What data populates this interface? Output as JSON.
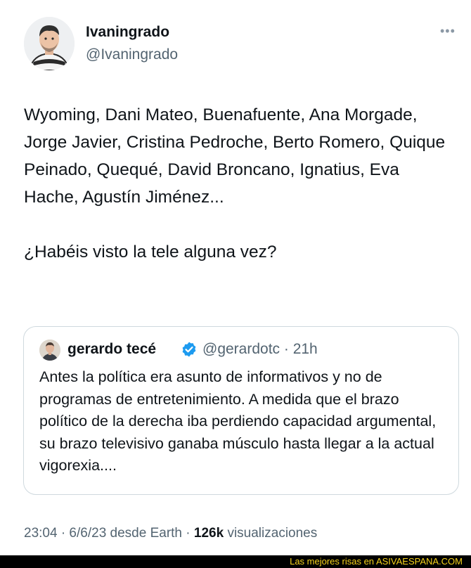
{
  "author": {
    "display_name": "Ivaningrado",
    "handle": "@Ivaningrado",
    "more_icon": "more-horizontal-icon"
  },
  "tweet": {
    "paragraph_1": "Wyoming, Dani Mateo, Buenafuente, Ana Morgade, Jorge Javier, Cristina Pedroche, Berto Romero, Quique Peinado, Quequé, David Broncano, Ignatius, Eva Hache, Agustín Jiménez...",
    "paragraph_2": "¿Habéis visto la tele alguna vez?"
  },
  "quoted_tweet": {
    "display_name": "gerardo tecé",
    "verified_icon": "verified-badge-icon",
    "handle_time": "@gerardotc · 21h",
    "text": "Antes la política era asunto de informativos y no de programas de entretenimiento. A medida que el brazo político de la derecha iba perdiendo capacidad argumental, su brazo televisivo ganaba músculo hasta llegar a la actual vigorexia...."
  },
  "meta": {
    "time_date": "23:04 · 6/6/23 desde Earth · ",
    "views_count": "126k",
    "views_label": " visualizaciones"
  },
  "watermark": {
    "prefix": "Las mejores risas en ",
    "site": "ASIVAESPANA.COM"
  },
  "colors": {
    "text": "#0f1419",
    "secondary": "#536471",
    "border": "#cfd9de",
    "verified": "#1d9bf0",
    "watermark_bg": "#000000",
    "watermark_text": "#f6d21c"
  }
}
